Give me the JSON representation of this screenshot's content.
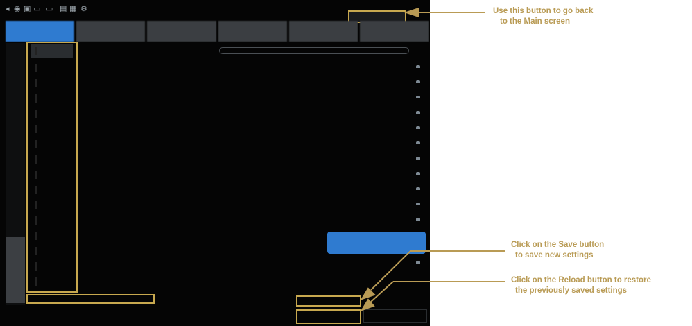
{
  "annotations": {
    "main": [
      "Use this button to go back",
      "to the Main screen"
    ],
    "save": [
      "Click on the Save button",
      "to save new settings"
    ],
    "reload": [
      "Click on the Reload button to restore",
      "the previously saved settings"
    ]
  },
  "colors": {
    "annotation": "#b99b55",
    "highlight_box": "#c7a84f",
    "active_tab": "#2f7bd0"
  }
}
